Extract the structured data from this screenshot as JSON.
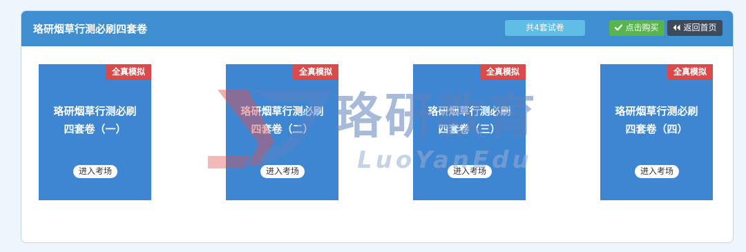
{
  "header": {
    "title": "珞研烟草行测必刷四套卷",
    "count_label": "共4套试卷",
    "buy_label": "点击购买",
    "back_label": "返回首页"
  },
  "watermark": {
    "cn_text": "珞研教育",
    "en_text": "LuoYanEdu"
  },
  "papers": [
    {
      "badge": "全真模拟",
      "title_line1": "珞研烟草行测必刷",
      "title_line2": "四套卷（一）",
      "enter_label": "进入考场"
    },
    {
      "badge": "全真模拟",
      "title_line1": "珞研烟草行测必刷",
      "title_line2": "四套卷（二）",
      "enter_label": "进入考场"
    },
    {
      "badge": "全真模拟",
      "title_line1": "珞研烟草行测必刷",
      "title_line2": "四套卷（三）",
      "enter_label": "进入考场"
    },
    {
      "badge": "全真模拟",
      "title_line1": "珞研烟草行测必刷",
      "title_line2": "四套卷（四）",
      "enter_label": "进入考场"
    }
  ],
  "colors": {
    "header_bg": "#3f8fd0",
    "card_bg": "#3e86d2",
    "badge_bg": "#db4a4a",
    "buy_bg": "#58b44d",
    "back_bg": "#3e4a5a",
    "count_bg": "#5fbde6"
  },
  "icons": {
    "buy": "check-icon",
    "back": "double-chevron-left-icon"
  }
}
